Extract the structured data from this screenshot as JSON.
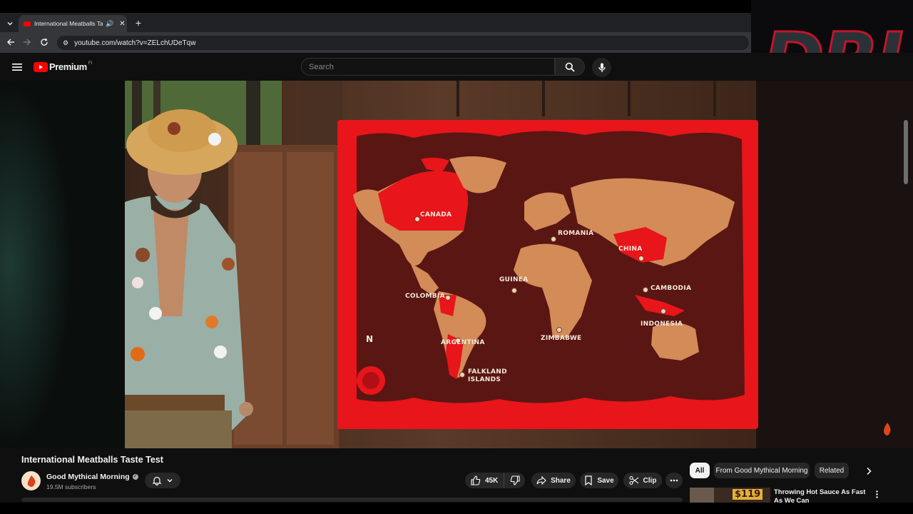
{
  "browser": {
    "tab_title": "International Meatballs Taste Test",
    "new_tab": "+",
    "url": "youtube.com/watch?v=ZELchUDeTqw"
  },
  "youtube": {
    "logo_text": "Premium",
    "logo_sup": "FI",
    "search_placeholder": "Search"
  },
  "overlay": {
    "logo_text": "DRJ"
  },
  "map": {
    "labels": [
      "CANADA",
      "ROMANIA",
      "CHINA",
      "GUINEA",
      "COLOMBIA",
      "CAMBODIA",
      "INDONESIA",
      "ZIMBABWE",
      "ARGENTINA",
      "FALKLAND",
      "ISLANDS"
    ],
    "compass_letter": "N"
  },
  "video_info": {
    "title": "International Meatballs Taste Test",
    "channel": "Good Mythical Morning",
    "subscribers": "19.5M subscribers",
    "likes": "45K",
    "share": "Share",
    "save": "Save",
    "clip": "Clip"
  },
  "sidebar": {
    "chips": [
      "All",
      "From Good Mythical Morning",
      "Related"
    ],
    "rec_title": "Throwing Hot Sauce As Fast As We Can",
    "rec_thumb_text": "$119"
  },
  "colors": {
    "youtube_red": "#ff0000",
    "map_red": "#e8151b",
    "map_land": "#d38b57",
    "map_ocean": "#5a1613"
  }
}
